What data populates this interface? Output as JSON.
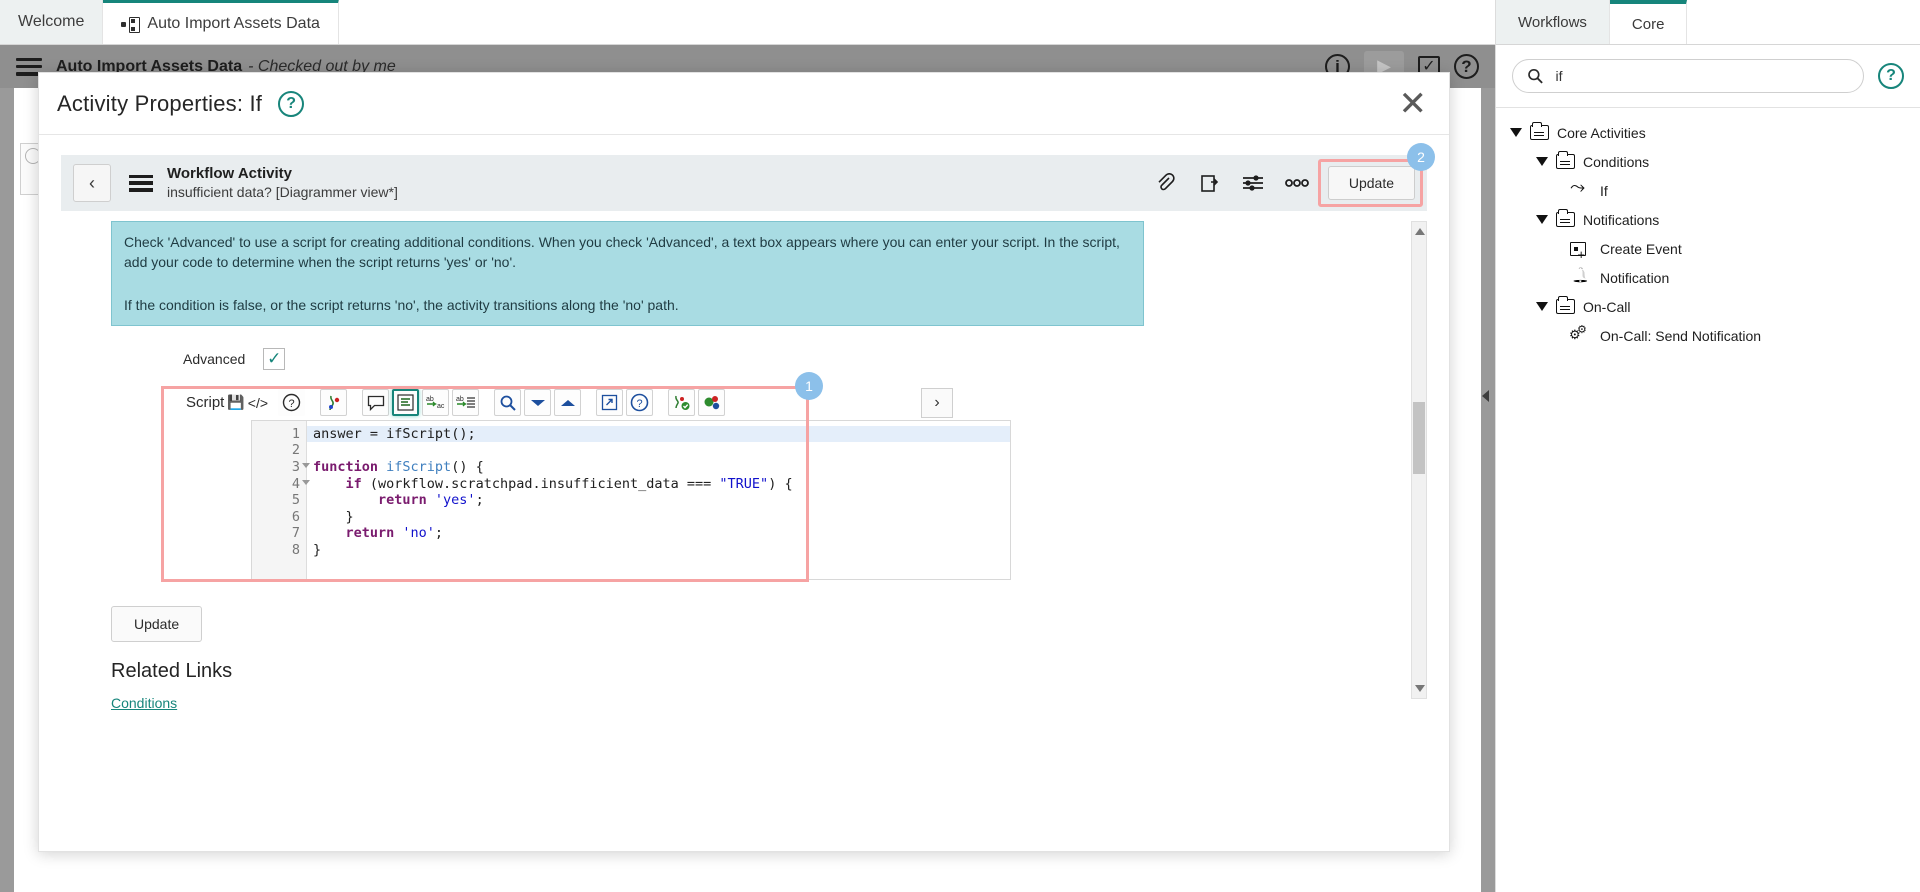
{
  "tabstrip": {
    "tabs": [
      {
        "label": "Welcome",
        "icon": "",
        "active": false
      },
      {
        "label": "Auto Import Assets Data",
        "icon": "workflow-icon",
        "active": true
      }
    ]
  },
  "app_header": {
    "title": "Auto Import Assets Data",
    "subtitle": "- Checked out by me",
    "icons": [
      "info-icon",
      "play-icon",
      "checklist-icon",
      "help-icon"
    ]
  },
  "dialog": {
    "title": "Activity Properties: If",
    "help_icon": "help-icon",
    "close_icon": "close-icon",
    "subbar": {
      "back_icon": "chevron-left-icon",
      "menu_icon": "hamburger-icon",
      "title": "Workflow Activity",
      "subtitle": "insufficient data? [Diagrammer view*]",
      "tools": [
        "attachment-icon",
        "clipboard-icon",
        "sliders-icon",
        "more-icon"
      ],
      "update_label": "Update",
      "badge": "2"
    },
    "info_banner": {
      "paragraph1": "Check 'Advanced' to use a script for creating additional conditions. When you check 'Advanced', a text box appears where you can enter your script. In the script, add your code to determine when the script returns 'yes' or 'no'.",
      "paragraph2": "If the condition is false, or the script returns 'no', the activity transitions along the 'no' path."
    },
    "advanced": {
      "label": "Advanced",
      "checked_glyph": "✓"
    },
    "script": {
      "label": "Script",
      "save_glyph": "save-icon",
      "code_glyph": "code-icon",
      "badge": "1",
      "toolbar_icons": [
        "help-icon",
        "syntax-icon",
        "comment-icon",
        "format-icon",
        "replace-icon",
        "replace-all-icon",
        "search-icon",
        "next-icon",
        "previous-icon",
        "popout-icon",
        "info-icon",
        "validate-icon",
        "debug-icon"
      ],
      "expand_icon": "chevron-right-icon",
      "lines": [
        {
          "n": "1",
          "fold": false,
          "selected": true,
          "tokens": [
            {
              "t": "answer = ",
              "c": "plain"
            },
            {
              "t": "ifScript",
              "c": "plain"
            },
            {
              "t": "();",
              "c": "plain"
            }
          ]
        },
        {
          "n": "2",
          "fold": false,
          "selected": false,
          "tokens": []
        },
        {
          "n": "3",
          "fold": true,
          "selected": false,
          "tokens": [
            {
              "t": "function ",
              "c": "kw"
            },
            {
              "t": "ifScript",
              "c": "fn"
            },
            {
              "t": "() {",
              "c": "plain"
            }
          ]
        },
        {
          "n": "4",
          "fold": true,
          "selected": false,
          "tokens": [
            {
              "t": "    if ",
              "c": "kw"
            },
            {
              "t": "(workflow.scratchpad.insufficient_data === ",
              "c": "plain"
            },
            {
              "t": "\"TRUE\"",
              "c": "str"
            },
            {
              "t": ") {",
              "c": "plain"
            }
          ]
        },
        {
          "n": "5",
          "fold": false,
          "selected": false,
          "tokens": [
            {
              "t": "        return ",
              "c": "kw"
            },
            {
              "t": "'yes'",
              "c": "str"
            },
            {
              "t": ";",
              "c": "plain"
            }
          ]
        },
        {
          "n": "6",
          "fold": false,
          "selected": false,
          "tokens": [
            {
              "t": "    }",
              "c": "plain"
            }
          ]
        },
        {
          "n": "7",
          "fold": false,
          "selected": false,
          "tokens": [
            {
              "t": "    return ",
              "c": "kw"
            },
            {
              "t": "'no'",
              "c": "str"
            },
            {
              "t": ";",
              "c": "plain"
            }
          ]
        },
        {
          "n": "8",
          "fold": false,
          "selected": false,
          "tokens": [
            {
              "t": "}",
              "c": "plain"
            }
          ]
        }
      ]
    },
    "update_bottom_label": "Update",
    "related_links_title": "Related Links",
    "related_links": [
      "Conditions"
    ]
  },
  "right_panel": {
    "tabs": [
      {
        "label": "Workflows",
        "active": true
      },
      {
        "label": "Core",
        "active": false
      }
    ],
    "search": {
      "value": "if",
      "placeholder": "",
      "icon": "search-icon"
    },
    "help_icon": "help-icon",
    "tree": [
      {
        "label": "Core Activities",
        "level": 0,
        "type": "folder",
        "expanded": true
      },
      {
        "label": "Conditions",
        "level": 1,
        "type": "folder",
        "expanded": true
      },
      {
        "label": "If",
        "level": 2,
        "type": "if-icon",
        "expanded": false
      },
      {
        "label": "Notifications",
        "level": 1,
        "type": "folder",
        "expanded": true
      },
      {
        "label": "Create Event",
        "level": 2,
        "type": "calendar-icon",
        "expanded": false
      },
      {
        "label": "Notification",
        "level": 2,
        "type": "bell-icon",
        "expanded": false
      },
      {
        "label": "On-Call",
        "level": 1,
        "type": "folder",
        "expanded": true
      },
      {
        "label": "On-Call: Send Notification",
        "level": 2,
        "type": "gears-icon",
        "expanded": false
      }
    ]
  },
  "colors": {
    "accent": "#16857b",
    "header_grey": "#8f8f8f",
    "info_banner": "#a9dce3",
    "highlight_outline": "#f6a3a3",
    "badge": "#8cc0ea"
  }
}
